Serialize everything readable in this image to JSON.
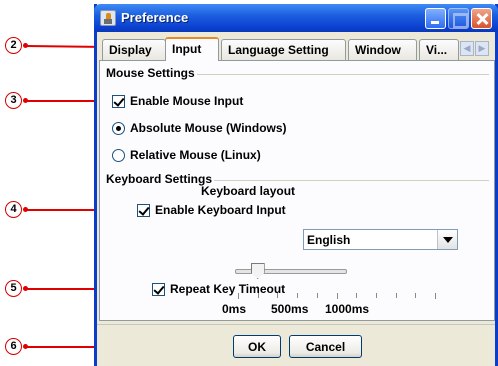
{
  "window": {
    "title": "Preference"
  },
  "tabs": [
    "Display",
    "Input",
    "Language Setting",
    "Window",
    "Vi..."
  ],
  "mouse_settings": {
    "header": "Mouse Settings",
    "enable_mouse_input": {
      "label": "Enable Mouse Input",
      "checked": true
    },
    "absolute_mouse": {
      "label": "Absolute Mouse (Windows)",
      "selected": true
    },
    "relative_mouse": {
      "label": "Relative Mouse (Linux)",
      "selected": false
    }
  },
  "keyboard_settings": {
    "header": "Keyboard Settings",
    "enable_keyboard_input": {
      "label": "Enable Keyboard Input",
      "checked": true
    },
    "keyboard_layout": {
      "label": "Keyboard layout",
      "value": "English"
    },
    "repeat_key_timeout": {
      "label": "Repeat Key Timeout",
      "checked": true
    },
    "slider": {
      "labels": [
        "0ms",
        "500ms",
        "1000ms"
      ],
      "value_ms": 100
    }
  },
  "buttons": {
    "ok": "OK",
    "cancel": "Cancel"
  },
  "callouts": [
    "2",
    "3",
    "4",
    "5",
    "6"
  ],
  "colors": {
    "titlebar": "#0a3fcf",
    "callout": "#e00000",
    "active_tab_accent": "#e68b2c"
  }
}
